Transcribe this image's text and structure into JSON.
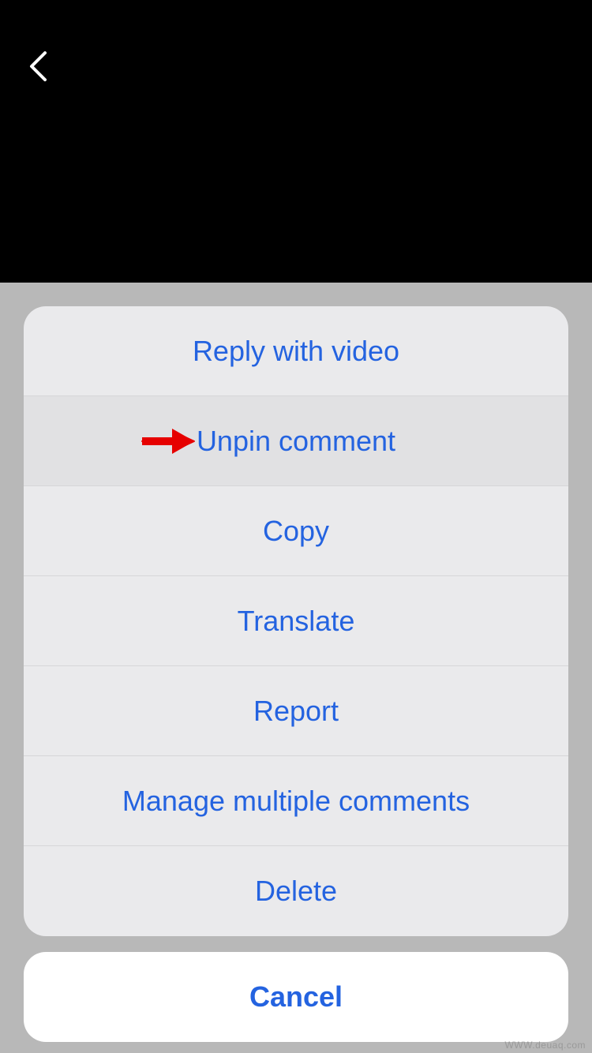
{
  "nav": {
    "back": "Back"
  },
  "actions": {
    "items": [
      {
        "label": "Reply with video",
        "highlighted": false
      },
      {
        "label": "Unpin comment",
        "highlighted": true
      },
      {
        "label": "Copy",
        "highlighted": false
      },
      {
        "label": "Translate",
        "highlighted": false
      },
      {
        "label": "Report",
        "highlighted": false
      },
      {
        "label": "Manage multiple comments",
        "highlighted": false
      },
      {
        "label": "Delete",
        "highlighted": false
      }
    ]
  },
  "cancel": {
    "label": "Cancel"
  },
  "annotation": {
    "arrow_index": 1
  },
  "watermark": "WWW.deuaq.com",
  "colors": {
    "link": "#2463e0",
    "sheet_bg": "#eaeaec",
    "backdrop": "#b8b8b8"
  }
}
